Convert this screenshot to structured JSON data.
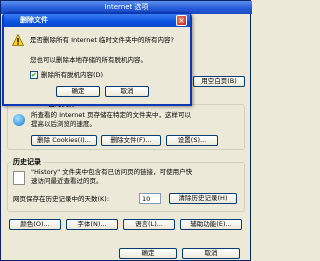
{
  "main": {
    "title": "Internet 选项",
    "right_button_partial": "用空白页(B)",
    "temp_files": {
      "group_label": "Internet 临时文件",
      "description_line1": "所查看的 Internet 页存储在特定的文件夹中，这样可以",
      "description_line2": "提高以后浏览的速度。",
      "delete_cookies_label": "删除 Cookies(I)...",
      "delete_files_label": "删除文件(F)...",
      "settings_label": "设置(S)..."
    },
    "history": {
      "group_label": "历史记录",
      "description_line1": "\"History\" 文件夹中包含有已访问页的链接，可使用户快",
      "description_line2": "速访问最近查看过的页。",
      "days_label": "网页保存在历史记录中的天数(K):",
      "days_value": "10",
      "clear_label": "清除历史记录(H)"
    },
    "bottom_buttons": [
      "颜色(O)...",
      "字体(N)...",
      "语言(L)...",
      "辅助功能(E)..."
    ],
    "ok_partial": "确定",
    "cancel_partial": "取消"
  },
  "dialog": {
    "title": "删除文件",
    "question": "是否删除所有 Internet 临时文件夹中的所有内容?",
    "note": "您也可以删除本地存储的所有脱机内容。",
    "checkbox_label": "删除所有脱机内容(D)",
    "checkbox_checked": true,
    "ok_label": "确定",
    "cancel_label": "取消"
  }
}
